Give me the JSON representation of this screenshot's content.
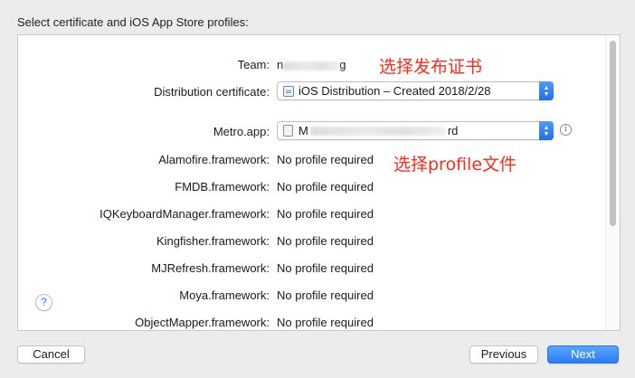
{
  "header": {
    "title": "Select certificate and iOS App Store profiles:"
  },
  "team": {
    "label": "Team:",
    "value_prefix": "n",
    "value_suffix": "g"
  },
  "distribution": {
    "label": "Distribution certificate:",
    "selected": "iOS Distribution – Created 2018/2/28"
  },
  "app": {
    "label": "Metro.app:",
    "value_prefix": "M",
    "value_suffix": "rd"
  },
  "frameworks": [
    {
      "label": "Alamofire.framework:",
      "value": "No profile required"
    },
    {
      "label": "FMDB.framework:",
      "value": "No profile required"
    },
    {
      "label": "IQKeyboardManager.framework:",
      "value": "No profile required"
    },
    {
      "label": "Kingfisher.framework:",
      "value": "No profile required"
    },
    {
      "label": "MJRefresh.framework:",
      "value": "No profile required"
    },
    {
      "label": "Moya.framework:",
      "value": "No profile required"
    },
    {
      "label": "ObjectMapper.framework:",
      "value": "No profile required"
    }
  ],
  "annotations": {
    "certificate": "选择发布证书",
    "profile": "选择profile文件"
  },
  "icons": {
    "help": "question-mark-icon",
    "info": "info-icon",
    "stepper": "up-down-chevron-icon"
  },
  "buttons": {
    "help": "?",
    "info": "i",
    "cancel": "Cancel",
    "previous": "Previous",
    "next": "Next"
  },
  "colors": {
    "accent": "#2a7cf1",
    "annotation": "#ff2a1a"
  }
}
